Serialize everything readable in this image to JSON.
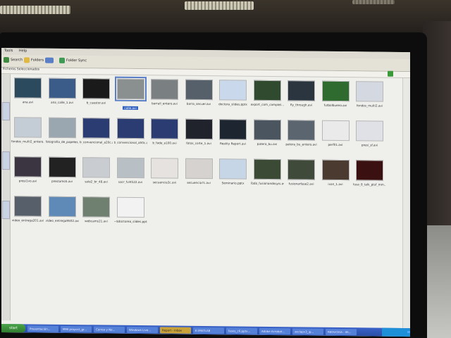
{
  "window": {
    "menu": [
      "Tools",
      "Help"
    ],
    "toolbar": {
      "search": "Search",
      "folders": "Folders",
      "folder_sync": "Folder Sync"
    },
    "address": "Ficheros Seleccionados"
  },
  "files": [
    {
      "name": "ana.avi",
      "color": "#2c4a5e"
    },
    {
      "name": "ana_calle_1.avi",
      "color": "#3b5c88"
    },
    {
      "name": "b_cuestor.avi",
      "color": "#1a1a1a"
    },
    {
      "name": "calle.avi",
      "color": "#8a8f90",
      "selected": true
    },
    {
      "name": "barrall_entero.avi",
      "color": "#7a7f82"
    },
    {
      "name": "barra_secuer.avi",
      "color": "#55606a"
    },
    {
      "name": "doctora_slides.pptx",
      "color": "#c9d8ea"
    },
    {
      "name": "export_com_complet...",
      "color": "#2f4a2f"
    },
    {
      "name": "fly_through.avi",
      "color": "#2a3540"
    },
    {
      "name": "futbolbueno.avi",
      "color": "#2f6a2f"
    },
    {
      "name": "fondos_multi2.avi",
      "color": "#d4d8e0"
    },
    {
      "name": "fondos_multi2_entero...",
      "color": "#c4ccd6"
    },
    {
      "name": "fotografia_de_papeles_lacanth...",
      "color": "#9aa6b0"
    },
    {
      "name": "b_convencional_a20c.avi",
      "color": "#2a3c72"
    },
    {
      "name": "b_convencional_a50c.avi",
      "color": "#2a3c72"
    },
    {
      "name": "b_fade_a100.avi",
      "color": "#2a3c72"
    },
    {
      "name": "fotos_corte_1.avi",
      "color": "#20232b"
    },
    {
      "name": "Reality Report.avi",
      "color": "#1c2530"
    },
    {
      "name": "patera_bu.avi",
      "color": "#4a5560"
    },
    {
      "name": "patera_bu_entero.avi",
      "color": "#5a6570"
    },
    {
      "name": "perfil1.avi",
      "color": "#eaeaea"
    },
    {
      "name": "presi_sf.avi",
      "color": "#dfe1e6"
    },
    {
      "name": "presi1vo.avi",
      "color": "#3a3540"
    },
    {
      "name": "prestamo5.avi",
      "color": "#222"
    },
    {
      "name": "sala2_br_48.avi",
      "color": "#c9cdd2"
    },
    {
      "name": "sacr_fvl4522.avi",
      "color": "#b8c0c6"
    },
    {
      "name": "secuencia3c.avi",
      "color": "#e6e2e0"
    },
    {
      "name": "secuencia7c.avi",
      "color": "#d6d2cf"
    },
    {
      "name": "Seminario.pptx",
      "color": "#c6d6e6"
    },
    {
      "name": "Todo_fusionandosyis.avi",
      "color": "#3a4a34"
    },
    {
      "name": "fusionarfase2.avi",
      "color": "#404a3a"
    },
    {
      "name": "ivan_1.avi",
      "color": "#4a3a30"
    },
    {
      "name": "fusa_8_talk_ptsf_mm...",
      "color": "#3a1010"
    },
    {
      "name": "video_entrega201.avi",
      "color": "#57606a"
    },
    {
      "name": "video_entrega9502.avi",
      "color": "#5f8ab8"
    },
    {
      "name": "webcams21.avi",
      "color": "#6f7f70"
    },
    {
      "name": "~$doctorea_slides.pptx",
      "color": "#f2f2f2"
    }
  ],
  "taskbar": {
    "start": "start",
    "tasks": [
      {
        "label": "Presentación..."
      },
      {
        "label": "MMI proyect_gr..."
      },
      {
        "label": "Correo y Ne..."
      },
      {
        "label": "Windows Live..."
      },
      {
        "label": "Report - Inbox",
        "active": true
      },
      {
        "label": "E:\\MATLAB"
      },
      {
        "label": "fases_c6.pptx..."
      },
      {
        "label": "Adobe Acrobat..."
      },
      {
        "label": "seclapv3_ip..."
      },
      {
        "label": "REDUCIDA - Mi..."
      }
    ]
  }
}
